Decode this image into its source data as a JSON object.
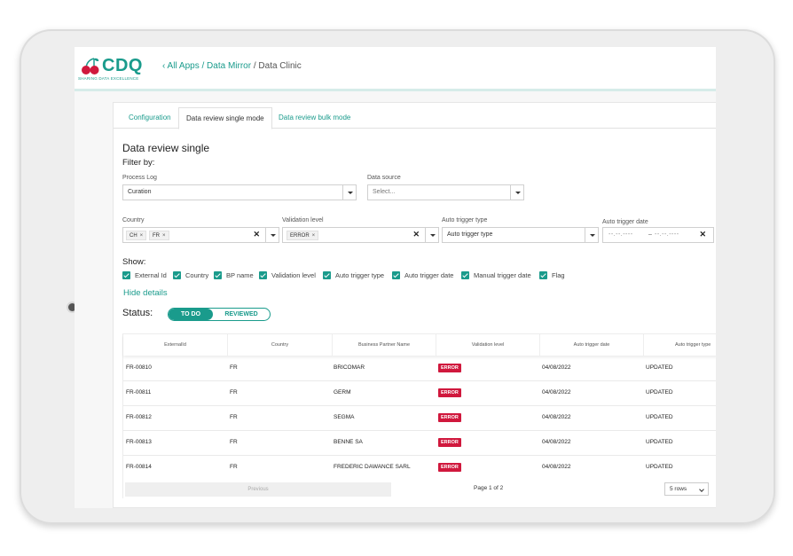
{
  "brand": {
    "name": "CDQ",
    "tagline": "SHARING DATA EXCELLENCE",
    "accent": "#1a9b8c",
    "cherry": "#d0183d"
  },
  "breadcrumb": {
    "back": "‹ All Apps",
    "sep1": " / ",
    "mid": "Data Mirror",
    "sep2": " / ",
    "current": "Data Clinic"
  },
  "tabs": [
    {
      "label": "Configuration"
    },
    {
      "label": "Data review single mode",
      "active": true
    },
    {
      "label": "Data review bulk mode"
    }
  ],
  "page": {
    "title": "Data review single",
    "filter_by": "Filter by:"
  },
  "filters": {
    "process_log": {
      "label": "Process Log",
      "value": "Curation"
    },
    "data_source": {
      "label": "Data source",
      "placeholder": "Select..."
    },
    "country": {
      "label": "Country",
      "chips": [
        "CH",
        "FR"
      ]
    },
    "validation_level": {
      "label": "Validation level",
      "chips": [
        "ERROR"
      ]
    },
    "auto_trigger_type": {
      "label": "Auto trigger type",
      "placeholder": "Auto trigger type"
    },
    "auto_trigger_date": {
      "label": "Auto trigger date",
      "from": "--.--.----",
      "to": "--.--.----",
      "range_sep": "–"
    }
  },
  "show": {
    "label": "Show:",
    "options": [
      "External Id",
      "Country",
      "BP name",
      "Validation level",
      "Auto trigger type",
      "Auto trigger date",
      "Manual trigger date",
      "Flag"
    ],
    "hide_details": "Hide details"
  },
  "status": {
    "label": "Status:",
    "todo": "TO DO",
    "reviewed": "REVIEWED",
    "selected": "TO DO"
  },
  "table": {
    "columns": [
      "ExternalId",
      "Country",
      "Business Partner Name",
      "Validation level",
      "Auto trigger date",
      "Auto trigger type"
    ],
    "rows": [
      {
        "external_id": "FR-00810",
        "country": "FR",
        "bp_name": "BRICOMAR",
        "level": "ERROR",
        "date": "04/08/2022",
        "type": "UPDATED"
      },
      {
        "external_id": "FR-00811",
        "country": "FR",
        "bp_name": "GERM",
        "level": "ERROR",
        "date": "04/08/2022",
        "type": "UPDATED"
      },
      {
        "external_id": "FR-00812",
        "country": "FR",
        "bp_name": "SEGMA",
        "level": "ERROR",
        "date": "04/08/2022",
        "type": "UPDATED"
      },
      {
        "external_id": "FR-00813",
        "country": "FR",
        "bp_name": "BENNE SA",
        "level": "ERROR",
        "date": "04/08/2022",
        "type": "UPDATED"
      },
      {
        "external_id": "FR-00814",
        "country": "FR",
        "bp_name": "FREDERIC DAWANCE SARL",
        "level": "ERROR",
        "date": "04/08/2022",
        "type": "UPDATED"
      }
    ],
    "pagination": {
      "previous": "Previous",
      "page_info": "Page 1 of 2",
      "rows_per_page": "5 rows"
    }
  }
}
